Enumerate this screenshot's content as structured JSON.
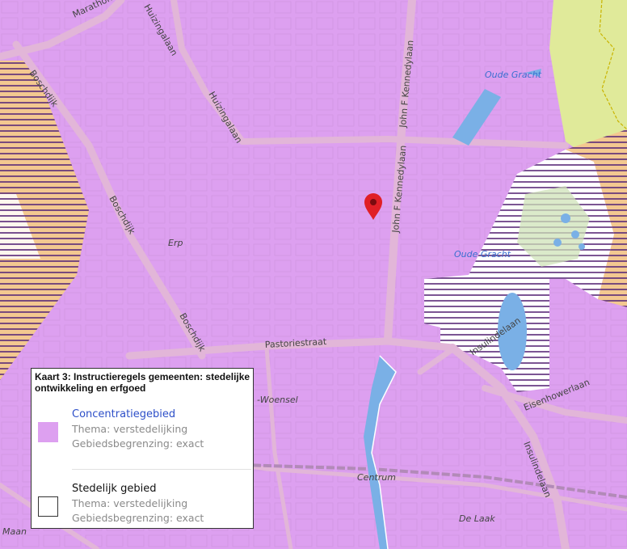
{
  "map": {
    "colors": {
      "concentratie": "#dda0f0",
      "road": "#e2b6d8",
      "water": "#7ab0e6",
      "green": "#e0ea9a",
      "hatch": "#5a2a78",
      "orange": "#f3c890",
      "marker": "#e01f26"
    },
    "marker_icon": "map-pin-icon",
    "street_labels": {
      "marathonloop": "Marathonloop",
      "huizingalaan_top": "Huizingalaan",
      "huizingalaan": "Huizingalaan",
      "john_kennedy_top": "John F Kennedylaan",
      "john_kennedy": "John F Kennedylaan",
      "boschdijk_top": "Boschdijk",
      "boschdijk_mid": "Boschdijk",
      "boschdijk_low": "Boschdijk",
      "pastoriestraat": "Pastoriestraat",
      "insulindelaan": "Insulindelaan",
      "insulindelaan_low": "Insulindelaan",
      "eisenhowerlaan": "Eisenhowerlaan"
    },
    "water_labels": {
      "oude_gracht_top": "Oude Gracht",
      "oude_gracht_mid": "Oude Gracht"
    },
    "area_labels": {
      "erp": "Erp",
      "woensel": "-Woensel",
      "centrum": "Centrum",
      "de_laak": "De Laak",
      "maan": "Maan"
    }
  },
  "legend": {
    "title": "Kaart 3: Instructieregels gemeenten: stedelijke ontwikkeling en erfgoed",
    "items": [
      {
        "name": "Concentratiegebied",
        "thema": "Thema: verstedelijking",
        "begrenzing": "Gebiedsbegrenzing: exact",
        "color": "#dda0f0",
        "name_color": "#2d4fc8"
      },
      {
        "name": "Stedelijk gebied",
        "thema": "Thema: verstedelijking",
        "begrenzing": "Gebiedsbegrenzing: exact",
        "color": "#ffffff",
        "name_color": "#111111"
      }
    ]
  }
}
